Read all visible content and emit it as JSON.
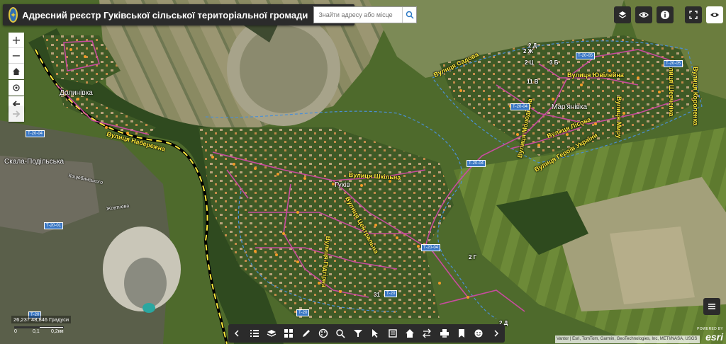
{
  "header": {
    "title": "Адресний реєстр Гуківської сільської територіальної громади",
    "logo_icon": "coat-of-arms-icon"
  },
  "search": {
    "placeholder": "Знайти адресу або місце",
    "icon": "search-icon"
  },
  "map_controls": {
    "zoom_in": "+",
    "zoom_out": "−",
    "home_icon": "home-icon",
    "locate_icon": "locate-icon",
    "back_icon": "back-arrow-icon",
    "forward_icon": "forward-arrow-icon"
  },
  "right_tools": [
    "layers-stack-icon",
    "eye-settings-icon",
    "info-icon",
    "fullscreen-icon",
    "visibility-icon"
  ],
  "bottom_toolbar": [
    "collapse-left-icon",
    "list-icon",
    "layers-icon",
    "basemap-grid-icon",
    "draw-pencil-icon",
    "palette-icon",
    "search-layer-icon",
    "filter-icon",
    "select-cursor-icon",
    "edit-form-icon",
    "home-icon",
    "swap-icon",
    "print-icon",
    "bookmark-icon",
    "face-icon",
    "collapse-right-icon"
  ],
  "place_labels": {
    "dolynivka": "Долинівка",
    "skala": "Скала-Подільська",
    "hukiv": "Гуків",
    "marianivka": "Мар'янівка"
  },
  "street_labels": {
    "naberezhna": "Вулиця Набережна",
    "shkilna": "Вулиця Шкільна",
    "tsentralna": "Вулиця Центральна",
    "pidhirna": "Вулиця Підгірна",
    "sadova": "Вулиця Садова",
    "yuvileina": "Вулиця Ювілейна",
    "shevchenka": "Вулиця Шевченка",
    "korolenka": "Вулиця Короленка",
    "myru": "Вулиця Миру",
    "lisova": "Вулиця Лісова",
    "heroiv": "Вулиця Героїв України",
    "molodizhna": "Вулиця Молодіжна",
    "kotsiubynskoho": "Коцюбинського",
    "zhovtneva": "Жовтнева"
  },
  "house_numbers": [
    "2 Д",
    "2 Ж",
    "3 Б",
    "2 Ц",
    "11 В",
    "2 Г",
    "31",
    "2 Д"
  ],
  "road_badges": [
    "Т-20-05",
    "Т-20-05",
    "Т-20-04",
    "Т-20-04",
    "Т-20-04",
    "Т-20-04",
    "Т-20-01",
    "Т-20",
    "Т-20",
    "Т-20"
  ],
  "coordinates": "26,237 48,846 Градуси",
  "scale": {
    "left": "0",
    "mid": "0,1",
    "right": "0,2км"
  },
  "attribution": "Vantor | Esri, TomTom, Garmin, GeoTechnologies, Inc, METI/NASA, USGS",
  "esri": {
    "powered_by": "POWERED BY",
    "name": "esri"
  },
  "colors": {
    "street": "#c84c9f",
    "border_yellow": "#ffeb3b",
    "boundary_blue": "#4a8fd6",
    "toolbar": "#2b2b2b"
  }
}
